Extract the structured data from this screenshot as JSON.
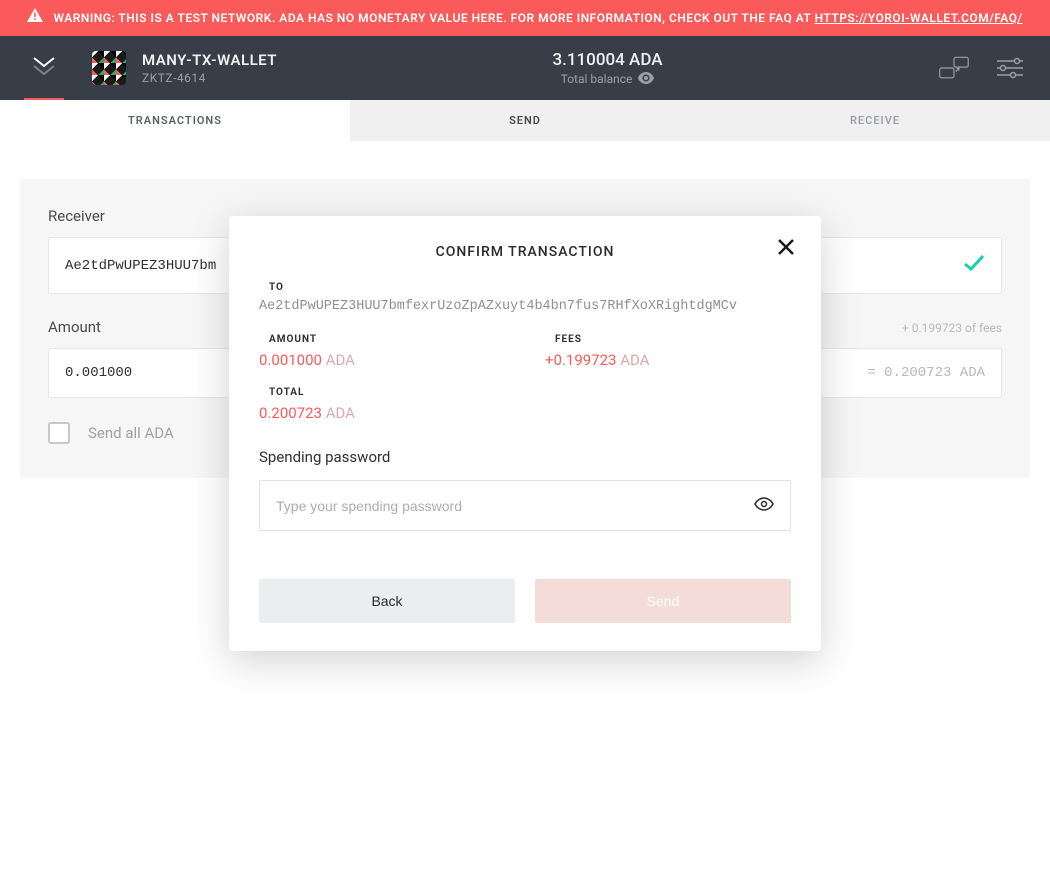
{
  "warning": {
    "text_main": "WARNING: THIS IS A TEST NETWORK. ADA HAS NO MONETARY VALUE HERE. FOR MORE INFORMATION, CHECK OUT THE FAQ AT ",
    "link": "HTTPS://YOROI-WALLET.COM/FAQ/"
  },
  "header": {
    "wallet_name": "MANY-TX-WALLET",
    "wallet_id": "ZKTZ-4614",
    "balance": "3.110004 ADA",
    "balance_label": "Total balance"
  },
  "tabs": {
    "transactions": "TRANSACTIONS",
    "send": "SEND",
    "receive": "RECEIVE"
  },
  "send_form": {
    "receiver_label": "Receiver",
    "receiver_value": "Ae2tdPwUPEZ3HUU7bm",
    "amount_label": "Amount",
    "amount_value": "0.001000",
    "fees_hint": "+ 0.199723 of fees",
    "total_hint": "= 0.200723 ADA",
    "send_all_label": "Send all ADA"
  },
  "modal": {
    "title": "CONFIRM TRANSACTION",
    "to_label": "TO",
    "to_address": "Ae2tdPwUPEZ3HUU7bmfexrUzoZpAZxuyt4b4bn7fus7RHfXoXRightdgMCv",
    "amount_label": "AMOUNT",
    "amount_value": "0.001000",
    "fees_label": "FEES",
    "fees_value": "+0.199723",
    "total_label": "TOTAL",
    "total_value": "0.200723",
    "currency": "ADA",
    "password_label": "Spending password",
    "password_placeholder": "Type your spending password",
    "back_label": "Back",
    "send_label": "Send"
  },
  "colors": {
    "accent_red": "#fa5b5a",
    "header_bg": "#373e47"
  }
}
